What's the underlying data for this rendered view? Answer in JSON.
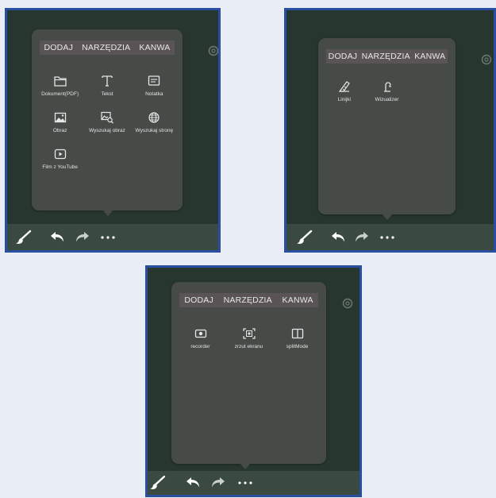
{
  "tabs": {
    "add": "DODAJ",
    "tools": "NARZĘDZIA",
    "canvas": "KANWA"
  },
  "add_menu": {
    "items": [
      {
        "label": "Dokument(PDF)",
        "icon": "folder-icon"
      },
      {
        "label": "Tekst",
        "icon": "text-icon"
      },
      {
        "label": "Notatka",
        "icon": "note-icon"
      },
      {
        "label": "Obraz",
        "icon": "image-icon"
      },
      {
        "label": "Wyszukaj obraz",
        "icon": "image-search-icon"
      },
      {
        "label": "Wyszukaj stronę",
        "icon": "globe-icon"
      },
      {
        "label": "Film z YouTube",
        "icon": "video-play-icon"
      }
    ]
  },
  "tools_menu": {
    "items": [
      {
        "label": "Linijki",
        "icon": "ruler-icon"
      },
      {
        "label": "Wizualizer",
        "icon": "visualizer-icon"
      }
    ]
  },
  "canvas_menu": {
    "items": [
      {
        "label": "recorder",
        "icon": "recorder-icon"
      },
      {
        "label": "zrzut ekranu",
        "icon": "screenshot-icon"
      },
      {
        "label": "splitMode",
        "icon": "split-mode-icon"
      }
    ]
  },
  "toolbar": {
    "items": [
      "brush-icon",
      "undo-icon",
      "redo-icon",
      "more-icon"
    ]
  },
  "colors": {
    "canvas": "#27372f",
    "panel": "#474b48",
    "tab_bar": "#5a5456",
    "toolbar": "#3b4a41",
    "frame_border": "#2b4fa0"
  }
}
